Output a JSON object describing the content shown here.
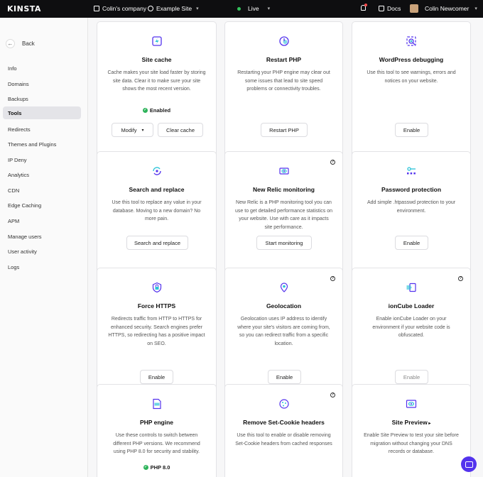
{
  "topbar": {
    "logo": "KINSTA",
    "company": "Colin's company",
    "site": "Example Site",
    "environment": "Live",
    "docs": "Docs",
    "user": "Colin Newcomer"
  },
  "sidebar": {
    "back": "Back",
    "items": [
      {
        "label": "Info"
      },
      {
        "label": "Domains"
      },
      {
        "label": "Backups"
      },
      {
        "label": "Tools",
        "active": true
      },
      {
        "label": "Redirects"
      },
      {
        "label": "Themes and Plugins"
      },
      {
        "label": "IP Deny"
      },
      {
        "label": "Analytics"
      },
      {
        "label": "CDN"
      },
      {
        "label": "Edge Caching"
      },
      {
        "label": "APM"
      },
      {
        "label": "Manage users"
      },
      {
        "label": "User activity"
      },
      {
        "label": "Logs"
      }
    ]
  },
  "cards": {
    "site_cache": {
      "title": "Site cache",
      "desc": "Cache makes your site load faster by storing site data. Clear it to make sure your site shows the most recent version.",
      "status": "Enabled",
      "btn1": "Modify",
      "btn2": "Clear cache"
    },
    "restart_php": {
      "title": "Restart PHP",
      "desc": "Restarting your PHP engine may clear out some issues that lead to site speed problems or connectivity troubles.",
      "btn": "Restart PHP"
    },
    "wp_debug": {
      "title": "WordPress debugging",
      "desc": "Use this tool to see warnings, errors and notices on your website.",
      "btn": "Enable"
    },
    "search_replace": {
      "title": "Search and replace",
      "desc": "Use this tool to replace any value in your database. Moving to a new domain? No more pain.",
      "btn": "Search and replace"
    },
    "new_relic": {
      "title": "New Relic monitoring",
      "desc": "New Relic is a PHP monitoring tool you can use to get detailed performance statistics on your website. Use with care as it impacts site performance.",
      "btn": "Start monitoring"
    },
    "password": {
      "title": "Password protection",
      "desc": "Add simple .htpasswd protection to your environment.",
      "btn": "Enable"
    },
    "force_https": {
      "title": "Force HTTPS",
      "desc": "Redirects traffic from HTTP to HTTPS for enhanced security. Search engines prefer HTTPS, so redirecting has a positive impact on SEO.",
      "btn": "Enable"
    },
    "geolocation": {
      "title": "Geolocation",
      "desc": "Geolocation uses IP address to identify where your site's visitors are coming from, so you can redirect traffic from a specific location.",
      "btn": "Enable"
    },
    "ioncube": {
      "title": "ionCube Loader",
      "desc": "Enable ionCube Loader on your environment if your website code is obfuscated.",
      "btn": "Enable"
    },
    "php_engine": {
      "title": "PHP engine",
      "desc": "Use these controls to switch between different PHP versions. We recommend using PHP 8.0 for security and stability.",
      "status": "PHP 8.0"
    },
    "set_cookie": {
      "title": "Remove Set-Cookie headers",
      "desc": "Use this tool to enable or disable removing Set-Cookie headers from cached responses"
    },
    "site_preview": {
      "title": "Site Preview",
      "desc": "Enable Site Preview to test your site before migration without changing your DNS records or database."
    }
  },
  "colors": {
    "accent": "#5333ed",
    "topbar": "#0e0e10",
    "enabled": "#2db35a"
  }
}
